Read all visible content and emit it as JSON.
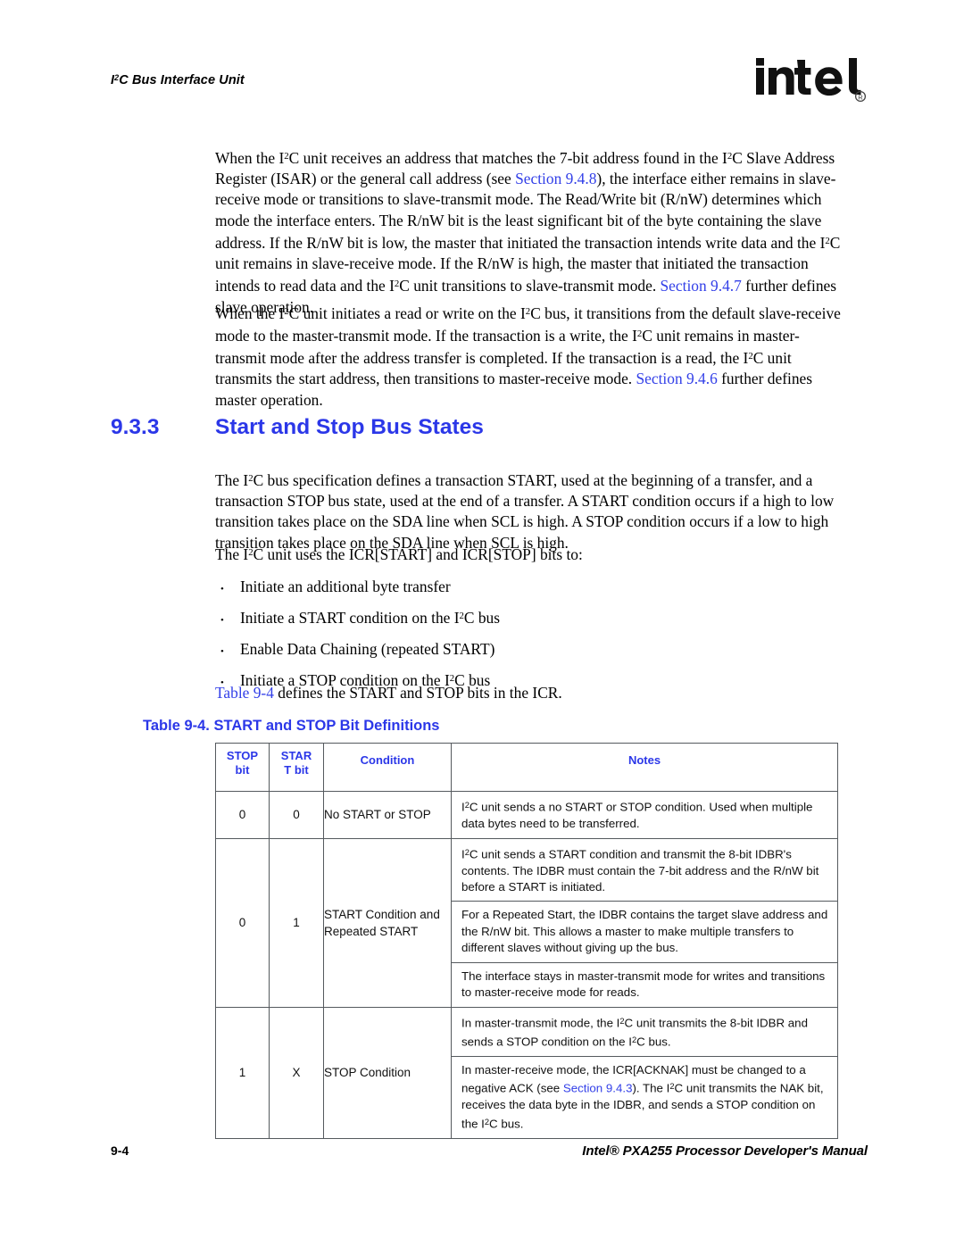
{
  "header": {
    "running_title_prefix": "I",
    "running_title_sup": "2",
    "running_title_rest": "C Bus Interface Unit",
    "logo_name": "intel-logo",
    "logo_text": "intel",
    "logo_registered": "®"
  },
  "paragraphs": {
    "p1_a": "When the I",
    "p1_sup1": "2",
    "p1_b": "C unit receives an address that matches the 7-bit address found in the I",
    "p1_sup2": "2",
    "p1_c": "C Slave Address Register (ISAR) or the general call address (see ",
    "p1_link1": "Section 9.4.8",
    "p1_d": "), the interface either remains in slave-receive mode or transitions to slave-transmit mode. The Read/Write bit (R/nW) determines which mode the interface enters. The R/nW bit is the least significant bit of the byte containing the slave address. If the R/nW bit is low, the master that initiated the transaction intends write data and the I",
    "p1_sup3": "2",
    "p1_e": "C unit remains in slave-receive mode. If the R/nW is high, the master that initiated the transaction intends to read data and the I",
    "p1_sup4": "2",
    "p1_f": "C unit transitions to slave-transmit mode. ",
    "p1_link2": "Section 9.4.7",
    "p1_g": " further defines slave operation.",
    "p2_a": "When the I",
    "p2_sup1": "2",
    "p2_b": "C unit initiates a read or write on the I",
    "p2_sup2": "2",
    "p2_c": "C bus, it transitions from the default slave-receive mode to the master-transmit mode. If the transaction is a write, the I",
    "p2_sup3": "2",
    "p2_d": "C unit remains in master-transmit mode after the address transfer is completed. If the transaction is a read, the I",
    "p2_sup4": "2",
    "p2_e": "C unit transmits the start address, then transitions to master-receive mode. ",
    "p2_link": "Section 9.4.6",
    "p2_f": " further defines master operation.",
    "p3_a": "The I",
    "p3_sup": "2",
    "p3_b": "C bus specification defines a transaction START, used at the beginning of a transfer, and a transaction STOP bus state, used at the end of a transfer. A START condition occurs if a high to low transition takes place on the SDA line when SCL is high. A STOP condition occurs if a low to high transition takes place on the SDA line when SCL is high.",
    "p4_a": "The I",
    "p4_sup": "2",
    "p4_b": "C unit uses the ICR[START] and ICR[STOP] bits to:",
    "p5_link": "Table 9-4",
    "p5_rest": " defines the START and STOP bits in the ICR."
  },
  "section": {
    "number": "9.3.3",
    "title": "Start and Stop Bus States"
  },
  "bullets": [
    {
      "marker": "•",
      "a": "Initiate an additional byte transfer",
      "sup": "",
      "b": ""
    },
    {
      "marker": "•",
      "a": "Initiate a START condition on the I",
      "sup": "2",
      "b": "C bus"
    },
    {
      "marker": "•",
      "a": "Enable Data Chaining (repeated START)",
      "sup": "",
      "b": ""
    },
    {
      "marker": "•",
      "a": "Initiate a STOP condition on the I",
      "sup": "2",
      "b": "C bus"
    }
  ],
  "table": {
    "caption": "Table 9-4. START and STOP Bit Definitions",
    "headers": {
      "stop_bit_line1": "STOP",
      "stop_bit_line2": "bit",
      "start_bit_line1": "STAR",
      "start_bit_line2": "T bit",
      "condition": "Condition",
      "notes": "Notes"
    },
    "rows": [
      {
        "stop": "0",
        "start": "0",
        "condition": "No START or STOP",
        "condition_sup": "",
        "condition_tail": "",
        "notes": [
          {
            "a": "I",
            "sup": "2",
            "b": "C unit sends a no START or STOP condition. Used when multiple data bytes need to be transferred."
          }
        ]
      },
      {
        "stop": "0",
        "start": "1",
        "condition": "START Condition and Repeated START",
        "condition_sup": "",
        "condition_tail": "",
        "notes": [
          {
            "a": "I",
            "sup": "2",
            "b": "C unit sends a START condition and transmit the 8-bit IDBR's contents. The IDBR must contain the 7-bit address and the R/nW bit before a START is initiated."
          },
          {
            "a": "",
            "sup": "",
            "b": "For a Repeated Start, the IDBR contains the target slave address and the R/nW bit. This allows a master to make multiple transfers to different slaves without giving up the bus."
          },
          {
            "a": "",
            "sup": "",
            "b": "The interface stays in master-transmit mode for writes and transitions to master-receive mode for reads."
          }
        ]
      },
      {
        "stop": "1",
        "start": "X",
        "condition": "STOP Condition",
        "condition_sup": "",
        "condition_tail": "",
        "notes": [
          {
            "a": "In master-transmit mode, the I",
            "sup": "2",
            "b": "C unit transmits the 8-bit IDBR and sends a STOP condition on the I",
            "sup2": "2",
            "c": "C bus."
          },
          {
            "a": "In master-receive mode, the ICR[ACKNAK] must be changed to a negative ACK (see ",
            "link": "Section 9.4.3",
            "b": "). The I",
            "sup2": "2",
            "c": "C unit transmits the NAK bit, receives the data byte in the IDBR, and sends a STOP condition on the I",
            "sup3": "2",
            "d": "C bus."
          }
        ]
      }
    ]
  },
  "footer": {
    "page_number": "9-4",
    "manual_title": "Intel® PXA255 Processor Developer's Manual"
  },
  "colors": {
    "link_blue": "#3340e8",
    "heading_blue": "#2b37e8",
    "table_border": "#555a5e",
    "text_black": "#000000"
  }
}
